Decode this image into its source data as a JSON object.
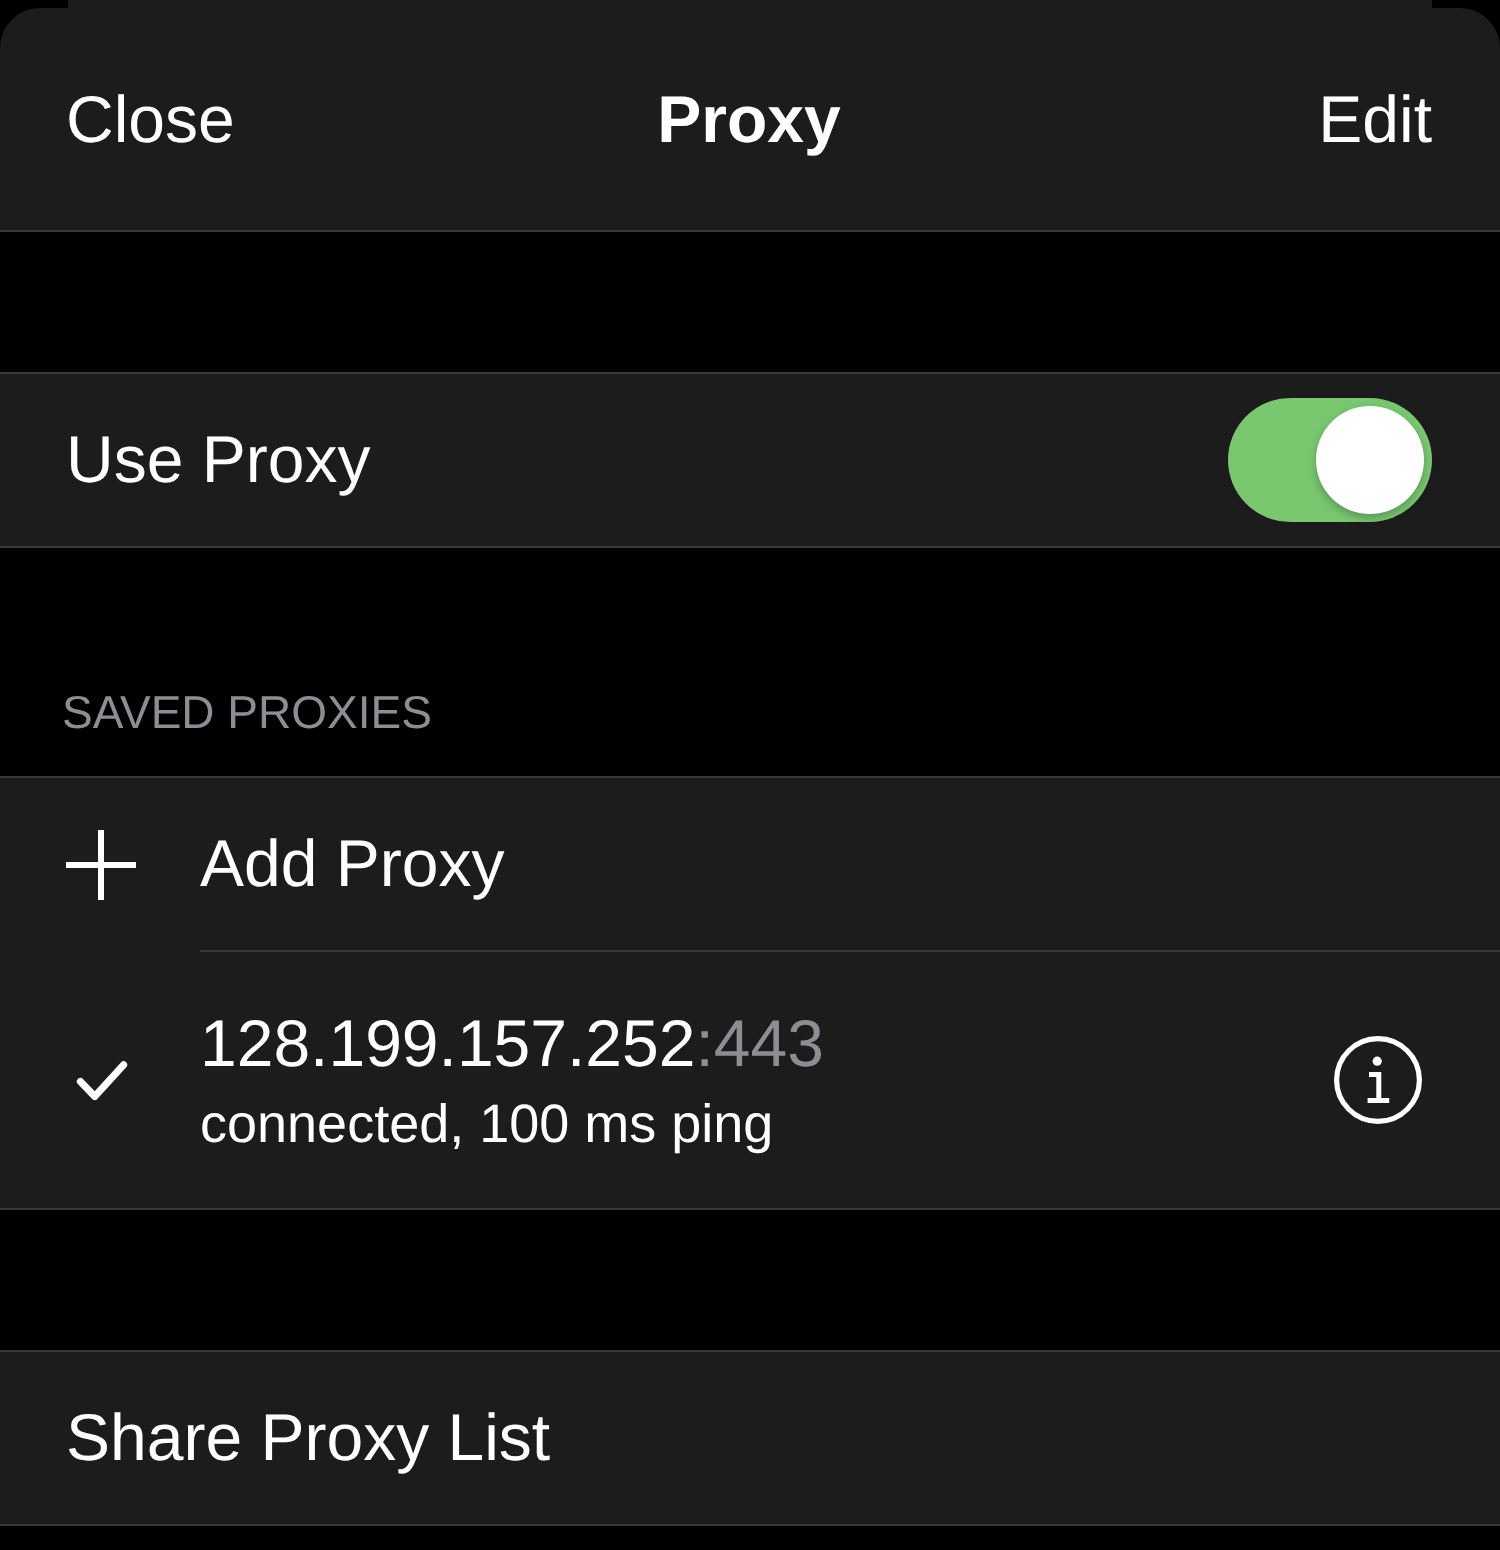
{
  "navigation": {
    "close": "Close",
    "title": "Proxy",
    "edit": "Edit"
  },
  "use_proxy": {
    "label": "Use Proxy",
    "on": true
  },
  "saved_proxies": {
    "header": "SAVED PROXIES",
    "add_button": "Add Proxy",
    "items": [
      {
        "host": "128.199.157.252",
        "port": ":443",
        "status": "connected, 100 ms ping",
        "selected": true
      }
    ]
  },
  "share_button": "Share Proxy List"
}
